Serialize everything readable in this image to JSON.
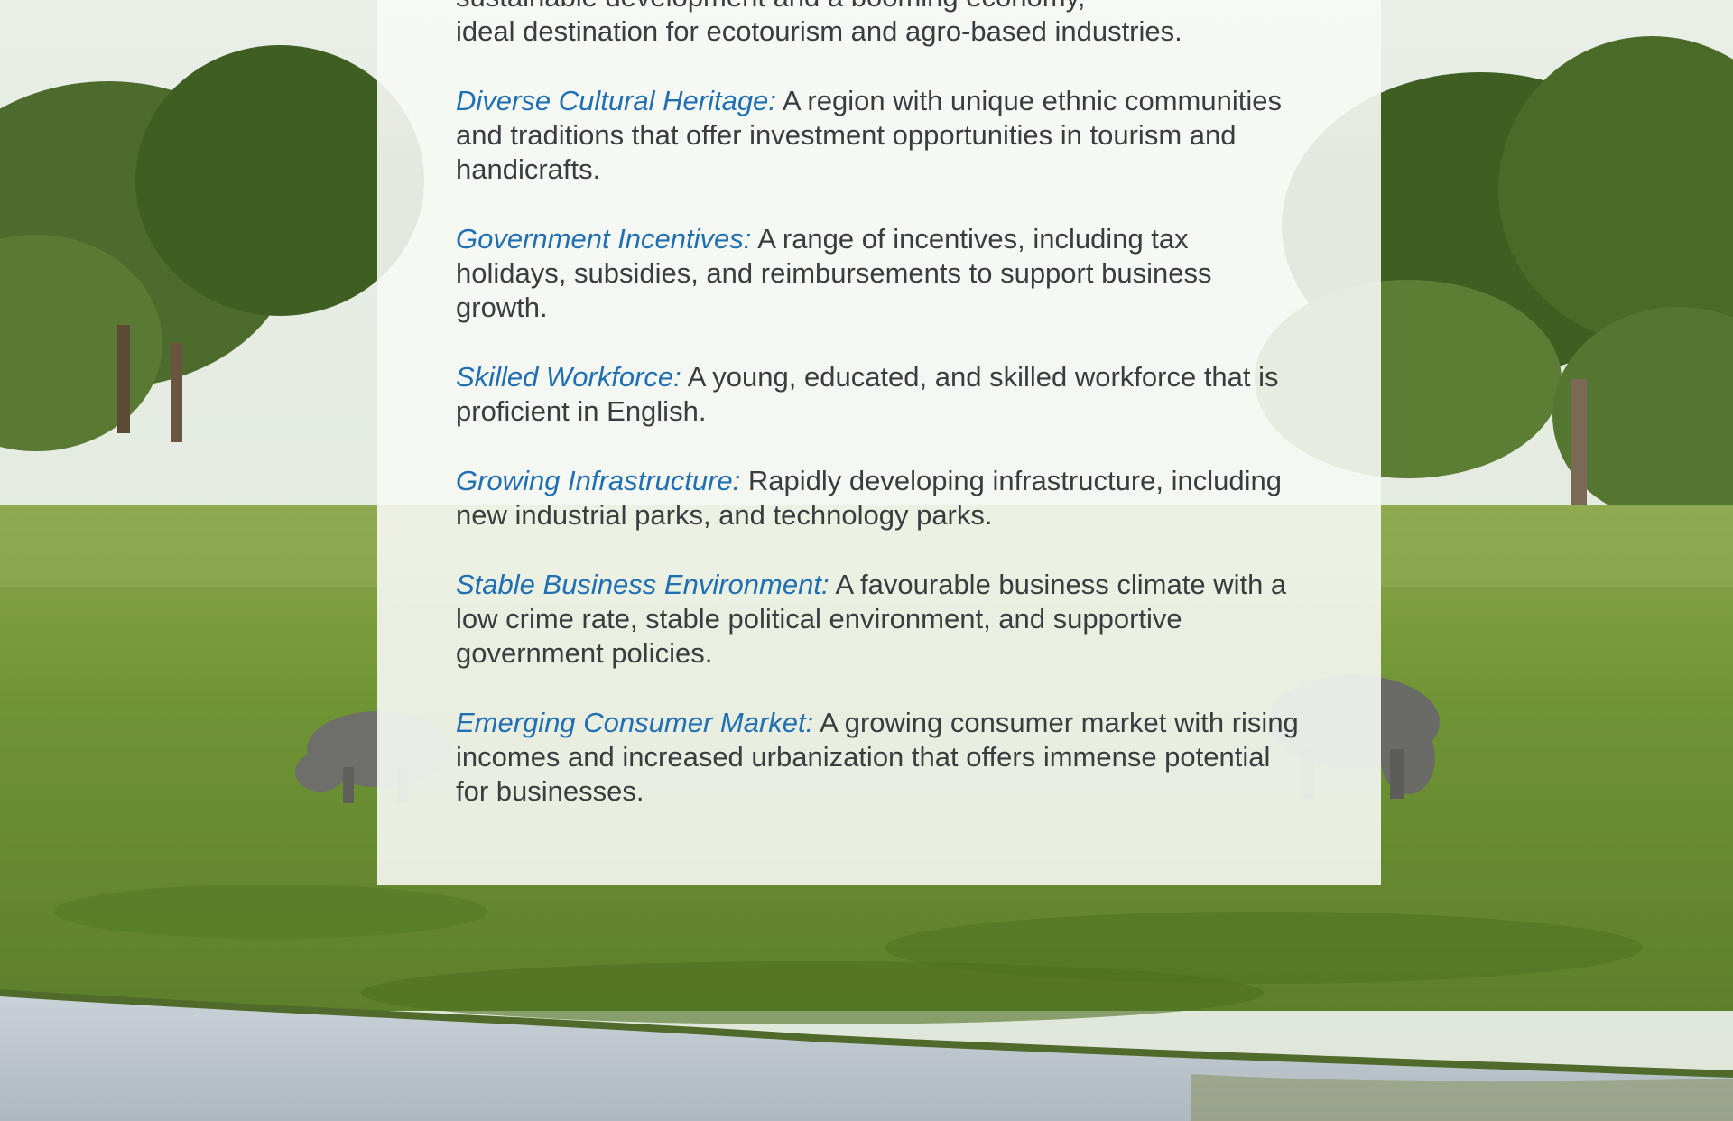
{
  "intro_fragment": {
    "line1": "sustainable development and a booming economy,",
    "line2": "ideal destination for ecotourism and agro-based industries."
  },
  "advantages": [
    {
      "term": "Diverse Cultural Heritage:",
      "text": " A region with unique ethnic communities and traditions that offer investment opportunities in tourism and handicrafts."
    },
    {
      "term": "Government Incentives:",
      "text": " A range of incentives, including tax holidays, subsidies, and reimbursements to support business growth."
    },
    {
      "term": "Skilled Workforce:",
      "text": " A young, educated, and skilled workforce that is proficient in English."
    },
    {
      "term": "Growing Infrastructure:",
      "text": " Rapidly developing infrastructure, including new industrial parks, and technology parks."
    },
    {
      "term": "Stable Business Environment:",
      "text": " A favourable business climate with a low crime rate, stable political environment, and supportive government policies."
    },
    {
      "term": "Emerging Consumer Market:",
      "text": " A growing consumer market with rising incomes and increased urbanization that offers immense potential for businesses."
    }
  ],
  "colors": {
    "term_accent": "#1f6fb2",
    "body_text": "#3a3d40",
    "card_background": "#f6f8f4"
  }
}
